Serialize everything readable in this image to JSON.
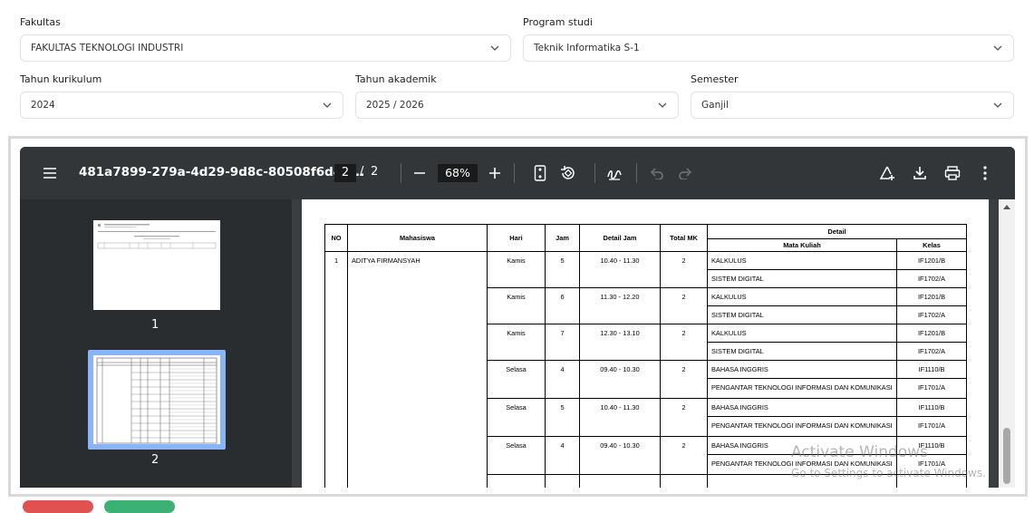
{
  "filters": {
    "fakultas": {
      "label": "Fakultas",
      "value": "FAKULTAS TEKNOLOGI INDUSTRI"
    },
    "program_studi": {
      "label": "Program studi",
      "value": "Teknik Informatika S-1"
    },
    "tahun_kurikulum": {
      "label": "Tahun kurikulum",
      "value": "2024"
    },
    "tahun_akademik": {
      "label": "Tahun akademik",
      "value": "2025 / 2026"
    },
    "semester": {
      "label": "Semester",
      "value": "Ganjil"
    }
  },
  "viewer": {
    "filename": "481a7899-279a-4d29-9d8c-80508f6d4d...",
    "current_page": "2",
    "page_sep": "/",
    "total_pages": "2",
    "zoom": "68%",
    "icons": [
      "menu-icon",
      "minus-icon",
      "plus-icon",
      "fit-page-icon",
      "rotate-icon",
      "draw-icon",
      "undo-icon",
      "redo-icon",
      "add-annotation-icon",
      "download-icon",
      "print-icon",
      "more-icon"
    ],
    "thumbnails": [
      {
        "label": "1"
      },
      {
        "label": "2"
      }
    ]
  },
  "table": {
    "headers": {
      "no": "NO",
      "mahasiswa": "Mahasiswa",
      "hari": "Hari",
      "jam": "Jam",
      "detail_jam": "Detail Jam",
      "total_mk": "Total MK",
      "detail": "Detail",
      "mata_kuliah": "Mata Kuliah",
      "kelas": "Kelas"
    },
    "student": {
      "no": "1",
      "name": "ADITYA FIRMANSYAH"
    },
    "groups": [
      {
        "hari": "Kamis",
        "jam": "5",
        "detail_jam": "10.40 - 11.30",
        "total": "2",
        "rows": [
          {
            "mk": "KALKULUS",
            "kelas": "IF1201/B"
          },
          {
            "mk": "SISTEM DIGITAL",
            "kelas": "IF1702/A"
          }
        ]
      },
      {
        "hari": "Kamis",
        "jam": "6",
        "detail_jam": "11.30 - 12.20",
        "total": "2",
        "rows": [
          {
            "mk": "KALKULUS",
            "kelas": "IF1201/B"
          },
          {
            "mk": "SISTEM DIGITAL",
            "kelas": "IF1702/A"
          }
        ]
      },
      {
        "hari": "Kamis",
        "jam": "7",
        "detail_jam": "12.30 - 13.10",
        "total": "2",
        "rows": [
          {
            "mk": "KALKULUS",
            "kelas": "IF1201/B"
          },
          {
            "mk": "SISTEM DIGITAL",
            "kelas": "IF1702/A"
          }
        ]
      },
      {
        "hari": "Selasa",
        "jam": "4",
        "detail_jam": "09.40 - 10.30",
        "total": "2",
        "rows": [
          {
            "mk": "BAHASA INGGRIS",
            "kelas": "IF1110/B"
          },
          {
            "mk": "PENGANTAR TEKNOLOGI INFORMASI DAN KOMUNIKASI",
            "kelas": "IF1701/A"
          }
        ]
      },
      {
        "hari": "Selasa",
        "jam": "5",
        "detail_jam": "10.40 - 11.30",
        "total": "2",
        "rows": [
          {
            "mk": "BAHASA INGGRIS",
            "kelas": "IF1110/B"
          },
          {
            "mk": "PENGANTAR TEKNOLOGI INFORMASI DAN KOMUNIKASI",
            "kelas": "IF1701/A"
          }
        ]
      },
      {
        "hari": "Selasa",
        "jam": "4",
        "detail_jam": "09.40 - 10.30",
        "total": "2",
        "rows": [
          {
            "mk": "BAHASA INGGRIS",
            "kelas": "IF1110/B"
          },
          {
            "mk": "PENGANTAR TEKNOLOGI INFORMASI DAN KOMUNIKASI",
            "kelas": "IF1701/A"
          }
        ]
      }
    ]
  },
  "watermark": {
    "line1": "Activate Windows",
    "line2": "Go to Settings to activate Windows."
  },
  "colors": {
    "viewer_bg": "#323639",
    "sidebar_bg": "#2a2d30",
    "thumb_selected": "#8ab4f8",
    "btn_red": "#e05252",
    "btn_green": "#3bb273"
  }
}
